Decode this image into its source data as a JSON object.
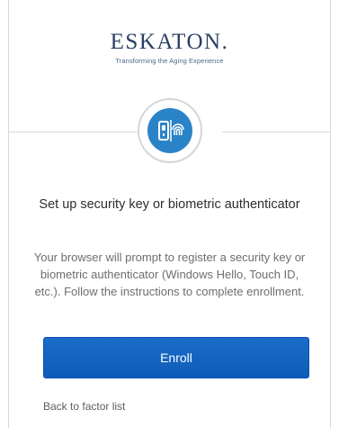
{
  "logo": {
    "word": "ESKATON.",
    "tagline": "Transforming the Aging Experience"
  },
  "icons": {
    "factor": "security-key-fingerprint-icon"
  },
  "colors": {
    "brand_navy": "#2a3f63",
    "badge_blue": "#2b83c7",
    "button_blue": "#0e5db8"
  },
  "content": {
    "title": "Set up security key or biometric authenticator",
    "description": "Your browser will prompt to register a security key or biometric authenticator (Windows Hello, Touch ID, etc.). Follow the instructions to complete enrollment."
  },
  "actions": {
    "enroll_label": "Enroll",
    "back_label": "Back to factor list"
  }
}
